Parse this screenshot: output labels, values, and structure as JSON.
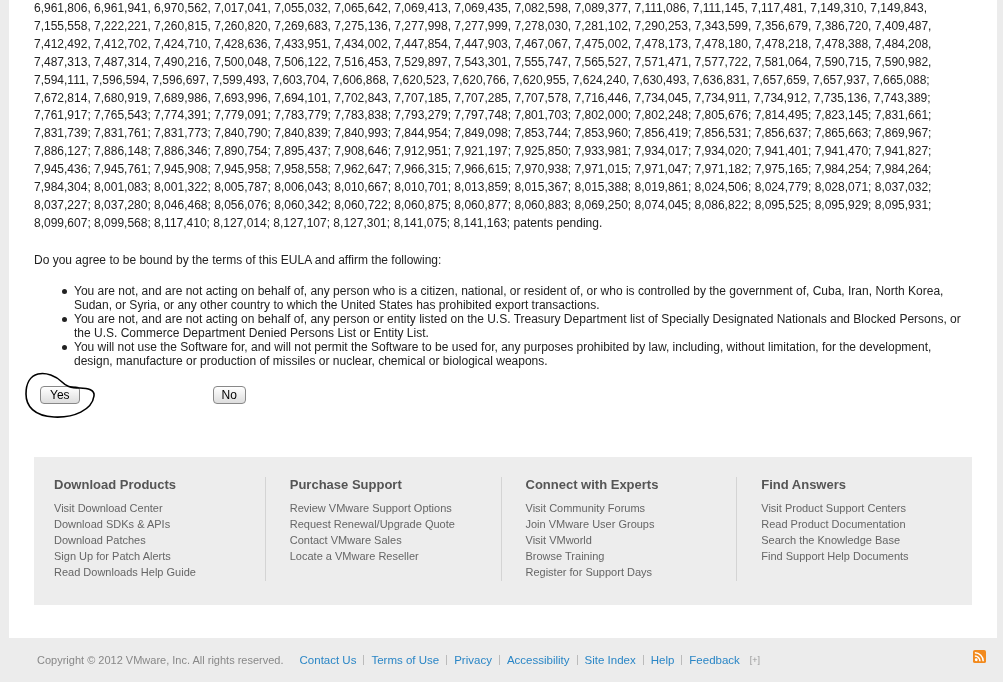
{
  "patents_text": "6,961,806, 6,961,941, 6,970,562, 7,017,041, 7,055,032, 7,065,642, 7,069,413, 7,069,435, 7,082,598, 7,089,377, 7,111,086, 7,111,145, 7,117,481, 7,149,310, 7,149,843, 7,155,558, 7,222,221, 7,260,815, 7,260,820, 7,269,683, 7,275,136, 7,277,998, 7,277,999, 7,278,030, 7,281,102, 7,290,253, 7,343,599, 7,356,679, 7,386,720, 7,409,487, 7,412,492, 7,412,702, 7,424,710, 7,428,636, 7,433,951, 7,434,002, 7,447,854, 7,447,903, 7,467,067, 7,475,002, 7,478,173, 7,478,180, 7,478,218, 7,478,388, 7,484,208, 7,487,313, 7,487,314, 7,490,216, 7,500,048, 7,506,122, 7,516,453, 7,529,897, 7,543,301, 7,555,747, 7,565,527, 7,571,471, 7,577,722, 7,581,064, 7,590,715, 7,590,982, 7,594,111, 7,596,594, 7,596,697, 7,599,493, 7,603,704, 7,606,868, 7,620,523, 7,620,766, 7,620,955, 7,624,240, 7,630,493, 7,636,831, 7,657,659, 7,657,937, 7,665,088; 7,672,814, 7,680,919, 7,689,986, 7,693,996, 7,694,101, 7,702,843, 7,707,185, 7,707,285, 7,707,578, 7,716,446, 7,734,045, 7,734,911, 7,734,912, 7,735,136, 7,743,389; 7,761,917; 7,765,543; 7,774,391; 7,779,091; 7,783,779; 7,783,838; 7,793,279; 7,797,748; 7,801,703; 7,802,000; 7,802,248; 7,805,676; 7,814,495; 7,823,145; 7,831,661; 7,831,739; 7,831,761; 7,831,773; 7,840,790; 7,840,839; 7,840,993; 7,844,954; 7,849,098; 7,853,744; 7,853,960; 7,856,419; 7,856,531; 7,856,637; 7,865,663; 7,869,967; 7,886,127; 7,886,148; 7,886,346; 7,890,754; 7,895,437; 7,908,646; 7,912,951; 7,921,197; 7,925,850; 7,933,981; 7,934,017; 7,934,020; 7,941,401; 7,941,470; 7,941,827; 7,945,436; 7,945,761; 7,945,908; 7,945,958; 7,958,558; 7,962,647; 7,966,315; 7,966,615; 7,970,938; 7,971,015; 7,971,047; 7,971,182; 7,975,165; 7,984,254; 7,984,264; 7,984,304; 8,001,083; 8,001,322; 8,005,787; 8,006,043; 8,010,667; 8,010,701; 8,013,859; 8,015,367; 8,015,388; 8,019,861; 8,024,506; 8,024,779; 8,028,071; 8,037,032; 8,037,227; 8,037,280; 8,046,468; 8,056,076; 8,060,342; 8,060,722; 8,060,875; 8,060,877; 8,060,883; 8,069,250; 8,074,045; 8,086,822; 8,095,525; 8,095,929; 8,095,931; 8,099,607; 8,099,568; 8,117,410; 8,127,014; 8,127,107; 8,127,301; 8,141,075; 8,141,163; patents pending.",
  "question": "Do you agree to be bound by the terms of this EULA and affirm the following:",
  "conditions": [
    "You are not, and are not acting on behalf of, any person who is a citizen, national, or resident of, or who is controlled by the government of, Cuba, Iran, North Korea, Sudan, or Syria, or any other country to which the United States has prohibited export transactions.",
    "You are not, and are not acting on behalf of, any person or entity listed on the U.S. Treasury Department list of Specially Designated Nationals and Blocked Persons, or the U.S. Commerce Department Denied Persons List or Entity List.",
    "You will not use the Software for, and will not permit the Software to be used for, any purposes prohibited by law, including, without limitation, for the development, design, manufacture or production of missiles or nuclear, chemical or biological weapons."
  ],
  "buttons": [
    {
      "label": "Yes"
    },
    {
      "label": "No"
    }
  ],
  "footer": {
    "columns": [
      {
        "heading": "Download Products",
        "links": [
          "Visit Download Center",
          "Download SDKs & APIs",
          "Download Patches",
          "Sign Up for Patch Alerts",
          "Read Downloads Help Guide"
        ]
      },
      {
        "heading": "Purchase Support",
        "links": [
          "Review VMware Support Options",
          "Request Renewal/Upgrade Quote",
          "Contact VMware Sales",
          "Locate a VMware Reseller"
        ]
      },
      {
        "heading": "Connect with Experts",
        "links": [
          "Visit Community Forums",
          "Join VMware User Groups",
          "Visit VMworld",
          "Browse Training",
          "Register for Support Days"
        ]
      },
      {
        "heading": "Find Answers",
        "links": [
          "Visit Product Support Centers",
          "Read Product Documentation",
          "Search the Knowledge Base",
          "Find Support Help Documents"
        ]
      }
    ]
  },
  "bottom_bar": {
    "copyright": "Copyright © 2012 VMware, Inc. All rights reserved.",
    "links": [
      "Contact Us",
      "Terms of Use",
      "Privacy",
      "Accessibility",
      "Site Index",
      "Help",
      "Feedback"
    ],
    "expand": "[+]"
  }
}
